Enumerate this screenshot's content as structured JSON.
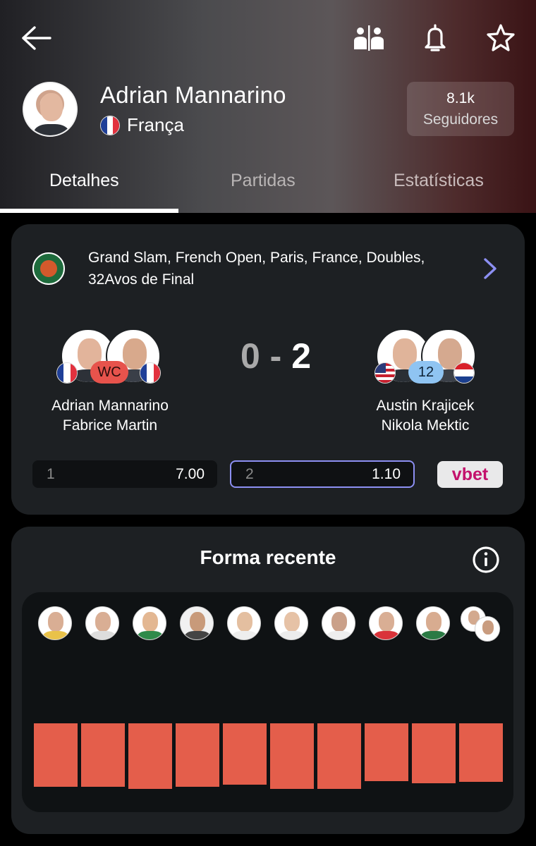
{
  "header": {
    "player_name": "Adrian Mannarino",
    "country": "França",
    "followers_count": "8.1k",
    "followers_label": "Seguidores",
    "icons": [
      "back-arrow-icon",
      "compare-icon",
      "bell-icon",
      "star-icon"
    ]
  },
  "tabs": [
    {
      "label": "Detalhes",
      "active": true
    },
    {
      "label": "Partidas",
      "active": false
    },
    {
      "label": "Estatísticas",
      "active": false
    }
  ],
  "match": {
    "tournament": "Grand Slam, French Open, Paris, France, Doubles, 32Avos de Final",
    "home": {
      "player1": "Adrian Mannarino",
      "player2": "Fabrice Martin",
      "badge": "WC"
    },
    "away": {
      "player1": "Austin Krajicek",
      "player2": "Nikola Mektic",
      "badge": "12"
    },
    "score_home": "0",
    "score_sep": "-",
    "score_away": "2",
    "odds": [
      {
        "key": "1",
        "value": "7.00",
        "selected": false
      },
      {
        "key": "2",
        "value": "1.10",
        "selected": true
      }
    ],
    "bookmaker": "vbet"
  },
  "form": {
    "title": "Forma recente",
    "results": [
      {
        "result": "loss",
        "level": 0.9
      },
      {
        "result": "loss",
        "level": 0.9
      },
      {
        "result": "loss",
        "level": 0.93
      },
      {
        "result": "loss",
        "level": 0.9
      },
      {
        "result": "loss",
        "level": 0.87
      },
      {
        "result": "loss",
        "level": 0.93
      },
      {
        "result": "loss",
        "level": 0.93
      },
      {
        "result": "loss",
        "level": 0.82
      },
      {
        "result": "loss",
        "level": 0.85
      },
      {
        "result": "loss",
        "level": 0.83
      }
    ],
    "colors": {
      "loss": "#e45e4b"
    }
  }
}
